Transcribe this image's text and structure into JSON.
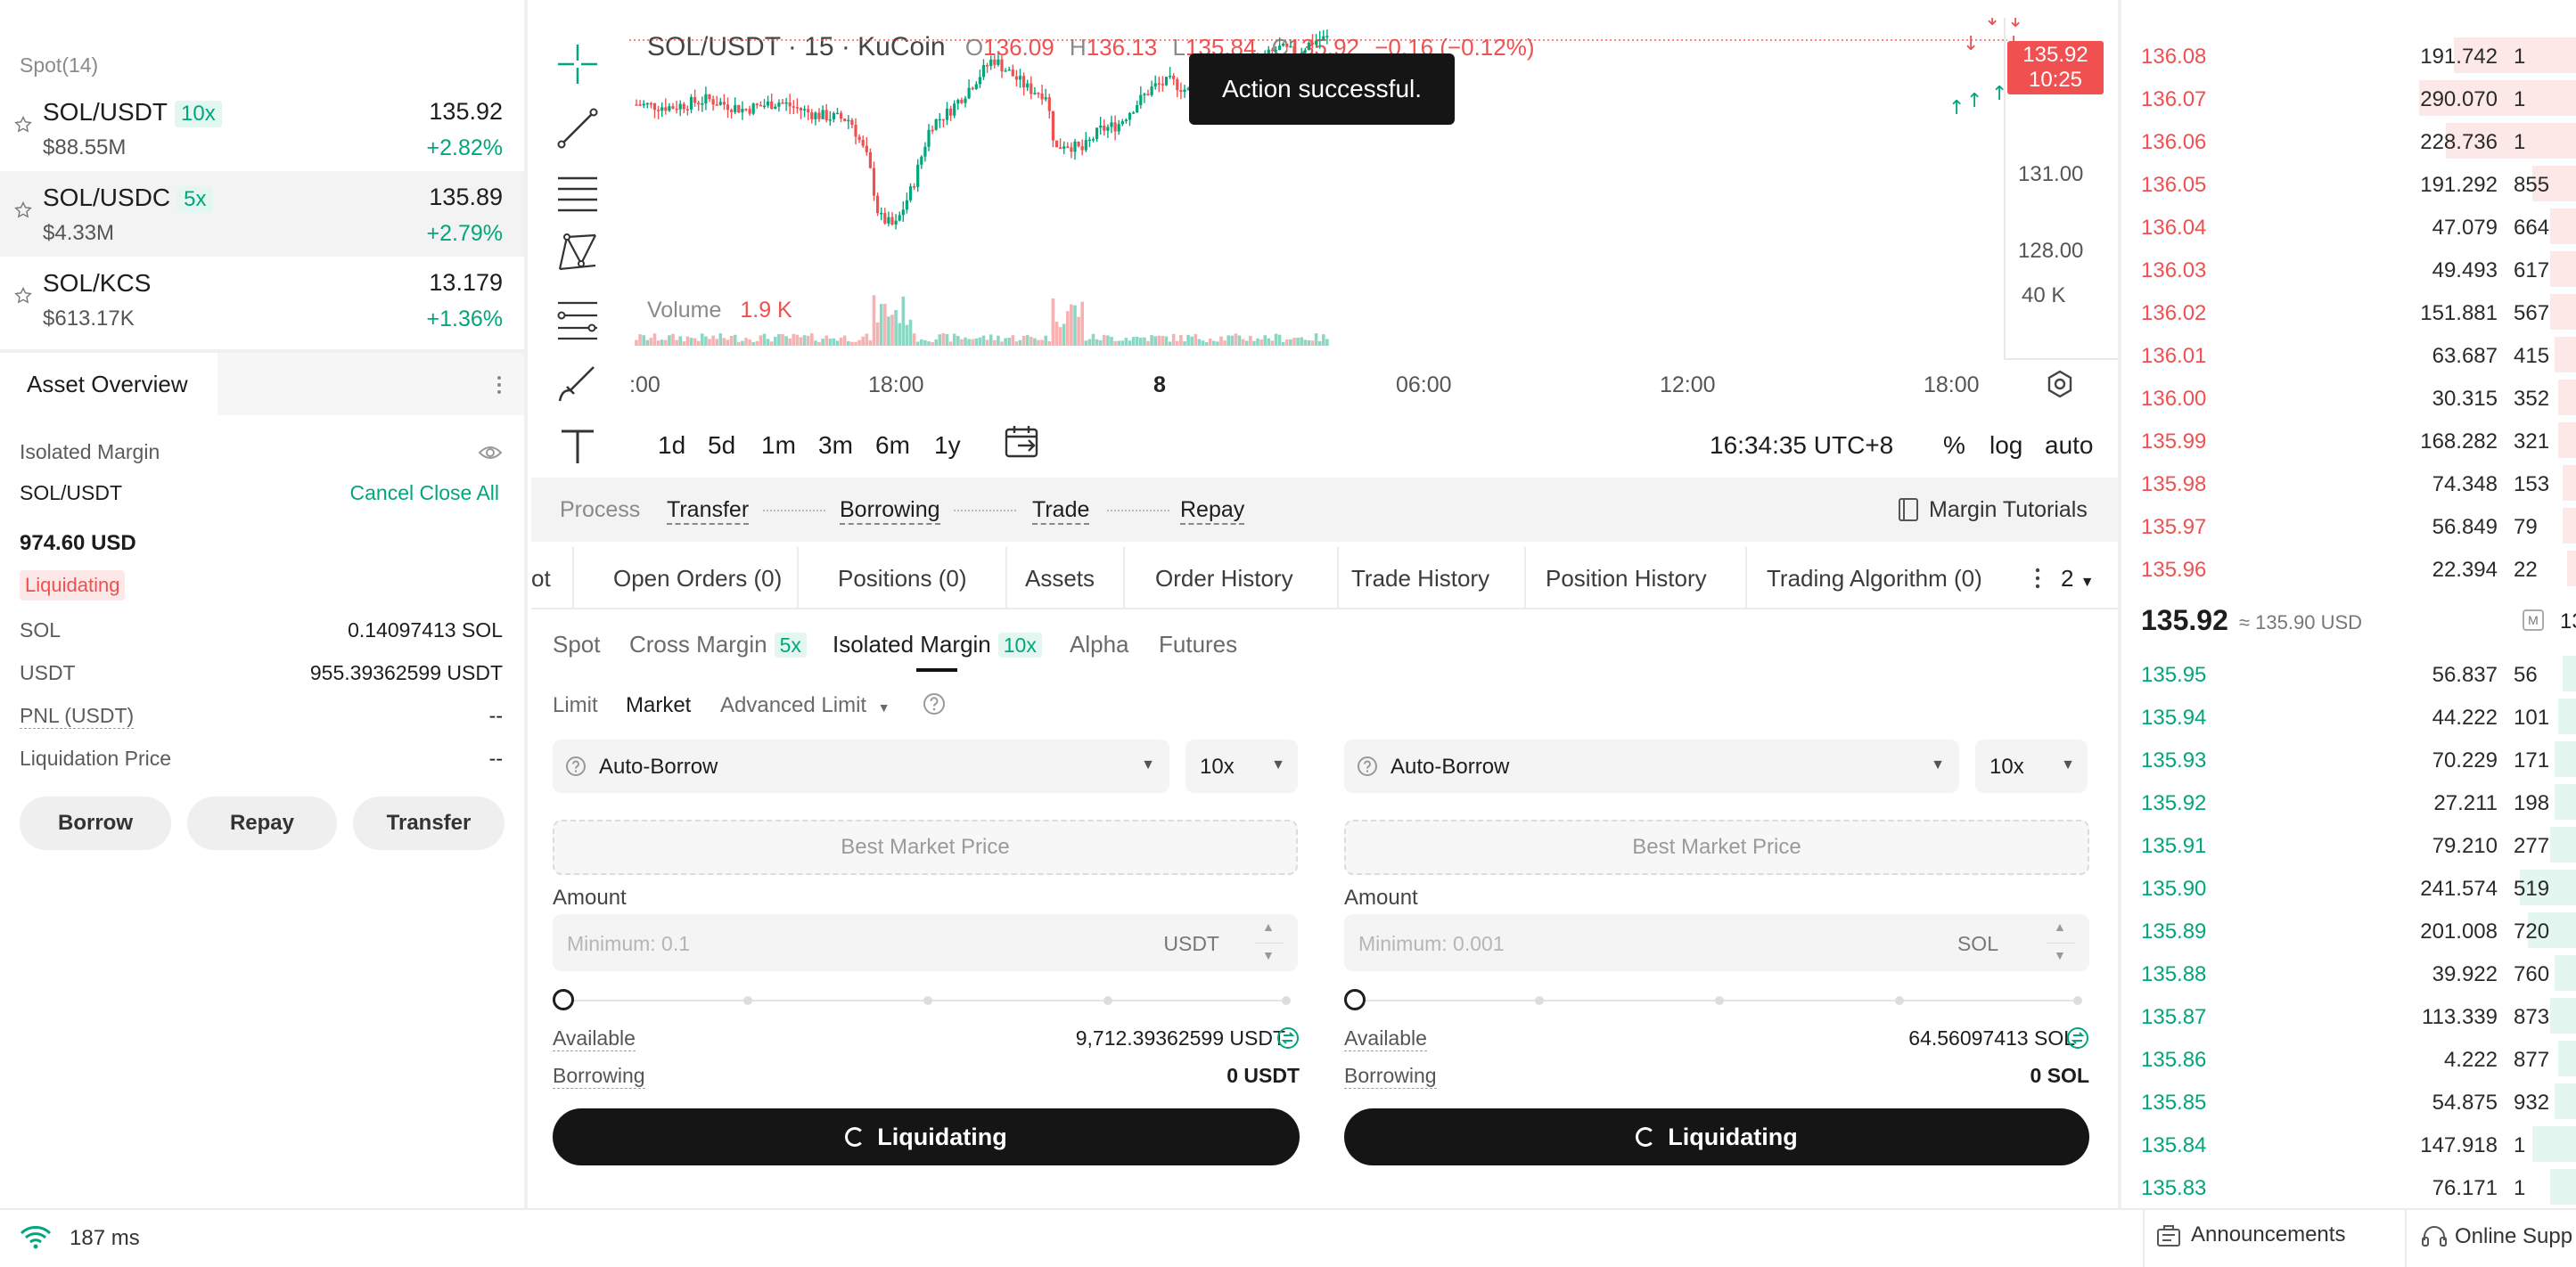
{
  "markets": {
    "header": "Spot(14)",
    "items": [
      {
        "pair": "SOL/USDT",
        "leverage": "10x",
        "volume": "$88.55M",
        "price": "135.92",
        "change": "+2.82%"
      },
      {
        "pair": "SOL/USDC",
        "leverage": "5x",
        "volume": "$4.33M",
        "price": "135.89",
        "change": "+2.79%"
      },
      {
        "pair": "SOL/KCS",
        "leverage": "",
        "volume": "$613.17K",
        "price": "13.179",
        "change": "+1.36%"
      }
    ]
  },
  "asset_overview": {
    "tab": "Asset Overview",
    "type_label": "Isolated Margin",
    "pair": "SOL/USDT",
    "cancel_close_all": "Cancel Close All",
    "total": "974.60 USD",
    "status_badge": "Liquidating",
    "rows": [
      {
        "label": "SOL",
        "value": "0.14097413 SOL"
      },
      {
        "label": "USDT",
        "value": "955.39362599 USDT"
      },
      {
        "label": "PNL (USDT)",
        "value": "--"
      },
      {
        "label": "Liquidation Price",
        "value": "--"
      }
    ],
    "buttons": [
      "Borrow",
      "Repay",
      "Transfer"
    ]
  },
  "chart": {
    "symbol": "SOL/USDT · 15 · KuCoin",
    "ohlc": {
      "o_label": "O",
      "o": "136.09",
      "h_label": "H",
      "h": "136.13",
      "l_label": "L",
      "l": "135.84",
      "c_label": "C",
      "c": "135.92",
      "chg": "−0.16 (−0.12%)"
    },
    "last_price": "135.92",
    "countdown": "10:25",
    "volume_label": "Volume",
    "volume_value": "1.9 K",
    "y_ticks": [
      "131.00",
      "128.00",
      "40 K"
    ],
    "x_ticks": [
      ":00",
      "18:00",
      "8",
      "06:00",
      "12:00",
      "18:00"
    ],
    "timeframes": [
      "1d",
      "5d",
      "1m",
      "3m",
      "6m",
      "1y"
    ],
    "clock": "16:34:35 UTC+8",
    "scale_opts": [
      "%",
      "log",
      "auto"
    ]
  },
  "chart_data": {
    "type": "candlestick",
    "title": "SOL/USDT · 15 · KuCoin",
    "x_ticks": [
      ":00",
      "18:00",
      "8",
      "06:00",
      "12:00",
      "18:00"
    ],
    "y_ticks": [
      131.0,
      128.0
    ],
    "last_price": 135.92,
    "ohlc_last": {
      "open": 136.09,
      "high": 136.13,
      "low": 135.84,
      "close": 135.92
    },
    "volume_ticks": [
      "40 K"
    ],
    "last_volume": "1.9 K"
  },
  "toast": "Action successful.",
  "process": {
    "label": "Process",
    "steps": [
      "Transfer",
      "Borrowing",
      "Trade",
      "Repay"
    ],
    "tutorials": "Margin Tutorials"
  },
  "tabs": {
    "items": [
      "ot",
      "Open Orders (0)",
      "Positions (0)",
      "Assets",
      "Order History",
      "Trade History",
      "Position History",
      "Trading Algorithm (0)"
    ],
    "count": "2"
  },
  "trade_types": {
    "items": [
      "Spot",
      "Cross Margin",
      "Isolated Margin",
      "Alpha",
      "Futures"
    ],
    "cross_lev": "5x",
    "isolated_lev": "10x"
  },
  "order_types": {
    "items": [
      "Limit",
      "Market",
      "Advanced Limit"
    ]
  },
  "buy": {
    "mode": "Auto-Borrow",
    "leverage": "10x",
    "price_placeholder": "Best Market Price",
    "amount_label": "Amount",
    "amount_placeholder": "Minimum: 0.1",
    "unit": "USDT",
    "available_label": "Available",
    "available_value": "9,712.39362599 USDT",
    "borrowing_label": "Borrowing",
    "borrowing_value": "0 USDT",
    "button": "Liquidating"
  },
  "sell": {
    "mode": "Auto-Borrow",
    "leverage": "10x",
    "price_placeholder": "Best Market Price",
    "amount_label": "Amount",
    "amount_placeholder": "Minimum: 0.001",
    "unit": "SOL",
    "available_label": "Available",
    "available_value": "64.56097413 SOL",
    "borrowing_label": "Borrowing",
    "borrowing_value": "0 SOL",
    "button": "Liquidating"
  },
  "orderbook": {
    "asks": [
      {
        "price": "136.08",
        "amount": "191.742",
        "total": "1"
      },
      {
        "price": "136.07",
        "amount": "290.070",
        "total": "1"
      },
      {
        "price": "136.06",
        "amount": "228.736",
        "total": "1"
      },
      {
        "price": "136.05",
        "amount": "191.292",
        "total": "855"
      },
      {
        "price": "136.04",
        "amount": "47.079",
        "total": "664"
      },
      {
        "price": "136.03",
        "amount": "49.493",
        "total": "617"
      },
      {
        "price": "136.02",
        "amount": "151.881",
        "total": "567"
      },
      {
        "price": "136.01",
        "amount": "63.687",
        "total": "415"
      },
      {
        "price": "136.00",
        "amount": "30.315",
        "total": "352"
      },
      {
        "price": "135.99",
        "amount": "168.282",
        "total": "321"
      },
      {
        "price": "135.98",
        "amount": "74.348",
        "total": "153"
      },
      {
        "price": "135.97",
        "amount": "56.849",
        "total": "79"
      },
      {
        "price": "135.96",
        "amount": "22.394",
        "total": "22"
      }
    ],
    "mid_price": "135.92",
    "mid_usd": "≈ 135.90 USD",
    "mid_right": "13",
    "bids": [
      {
        "price": "135.95",
        "amount": "56.837",
        "total": "56"
      },
      {
        "price": "135.94",
        "amount": "44.222",
        "total": "101"
      },
      {
        "price": "135.93",
        "amount": "70.229",
        "total": "171"
      },
      {
        "price": "135.92",
        "amount": "27.211",
        "total": "198"
      },
      {
        "price": "135.91",
        "amount": "79.210",
        "total": "277"
      },
      {
        "price": "135.90",
        "amount": "241.574",
        "total": "519"
      },
      {
        "price": "135.89",
        "amount": "201.008",
        "total": "720"
      },
      {
        "price": "135.88",
        "amount": "39.922",
        "total": "760"
      },
      {
        "price": "135.87",
        "amount": "113.339",
        "total": "873"
      },
      {
        "price": "135.86",
        "amount": "4.222",
        "total": "877"
      },
      {
        "price": "135.85",
        "amount": "54.875",
        "total": "932"
      },
      {
        "price": "135.84",
        "amount": "147.918",
        "total": "1"
      },
      {
        "price": "135.83",
        "amount": "76.171",
        "total": "1"
      }
    ]
  },
  "footer": {
    "latency": "187 ms",
    "announcements": "Announcements",
    "support": "Online Supp"
  },
  "colors": {
    "up": "#01a67c",
    "down": "#f05050",
    "button": "#151515"
  }
}
